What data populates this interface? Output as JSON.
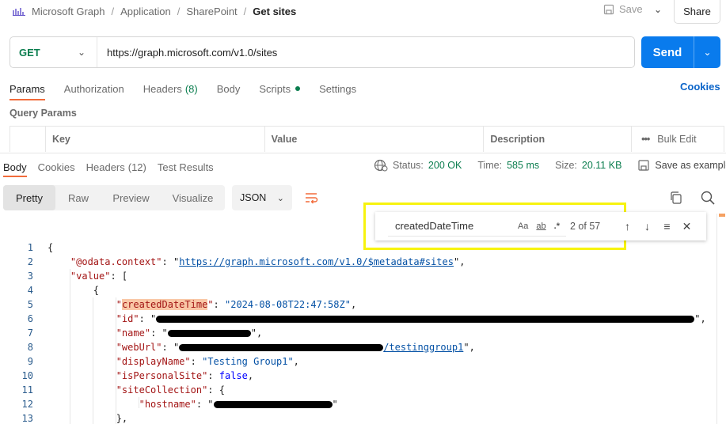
{
  "breadcrumb": {
    "items": [
      "Microsoft Graph",
      "Application",
      "SharePoint"
    ],
    "current": "Get sites"
  },
  "header": {
    "save_label": "Save",
    "share_label": "Share"
  },
  "request": {
    "method": "GET",
    "url": "https://graph.microsoft.com/v1.0/sites",
    "send_label": "Send"
  },
  "request_tabs": {
    "params": "Params",
    "authorization": "Authorization",
    "headers": "Headers",
    "headers_count": "(8)",
    "body": "Body",
    "scripts": "Scripts",
    "settings": "Settings",
    "cookies": "Cookies"
  },
  "query_params": {
    "label": "Query Params",
    "columns": {
      "key": "Key",
      "value": "Value",
      "description": "Description",
      "bulk_edit": "Bulk Edit"
    }
  },
  "response_tabs": {
    "body": "Body",
    "cookies": "Cookies",
    "headers": "Headers",
    "headers_count": "(12)",
    "test_results": "Test Results"
  },
  "response_status": {
    "status_label": "Status:",
    "status_value": "200 OK",
    "time_label": "Time:",
    "time_value": "585 ms",
    "size_label": "Size:",
    "size_value": "20.11 KB",
    "save_example": "Save as example",
    "more": "ooo"
  },
  "view_modes": {
    "pretty": "Pretty",
    "raw": "Raw",
    "preview": "Preview",
    "visualize": "Visualize"
  },
  "format": "JSON",
  "find": {
    "query": "createdDateTime",
    "match_case": "Aa",
    "whole_word": "ab",
    "regex": ".*",
    "count": "2 of 57"
  },
  "code": {
    "line_numbers": [
      "1",
      "2",
      "3",
      "4",
      "5",
      "6",
      "7",
      "8",
      "9",
      "10",
      "11",
      "12",
      "13"
    ],
    "odata_key": "\"@odata.context\"",
    "odata_value": "https://graph.microsoft.com/v1.0/$metadata#sites",
    "value_key": "\"value\"",
    "created_key": "createdDateTime",
    "created_value": "\"2024-08-08T22:47:58Z\"",
    "id_key": "\"id\"",
    "name_key": "\"name\"",
    "weburl_key": "\"webUrl\"",
    "weburl_tail": "/testinggroup1",
    "displayname_key": "\"displayName\"",
    "displayname_value": "\"Testing Group1\"",
    "personal_key": "\"isPersonalSite\"",
    "personal_value": "false",
    "sitecoll_key": "\"siteCollection\"",
    "hostname_key": "\"hostname\""
  }
}
